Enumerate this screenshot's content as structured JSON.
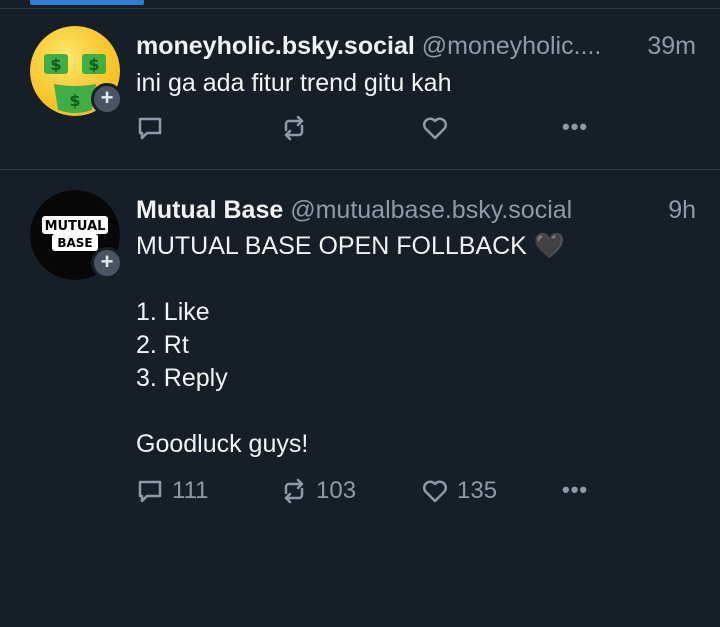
{
  "posts": [
    {
      "display_name": "moneyholic.bsky.social",
      "handle": "@moneyholic....",
      "time": "39m",
      "text": "ini ga ada fitur trend gitu kah",
      "avatar_icon": "money-face-emoji-icon",
      "counts": {
        "reply": "",
        "repost": "",
        "like": ""
      }
    },
    {
      "display_name": "Mutual Base",
      "handle": "@mutualbase.bsky.social",
      "time": "9h",
      "text": "MUTUAL BASE OPEN FOLLBACK 🖤\n\n1. Like\n2. Rt\n3. Reply\n\nGoodluck guys!",
      "avatar_label": [
        "MUTUAL",
        "BASE"
      ],
      "counts": {
        "reply": "111",
        "repost": "103",
        "like": "135"
      }
    }
  ],
  "follow_badge_symbol": "+",
  "more_symbol": "•••",
  "colors": {
    "background": "#161e27",
    "text": "#f1f3f5",
    "muted": "#8d9aa8",
    "accent": "#2f7dd6"
  }
}
